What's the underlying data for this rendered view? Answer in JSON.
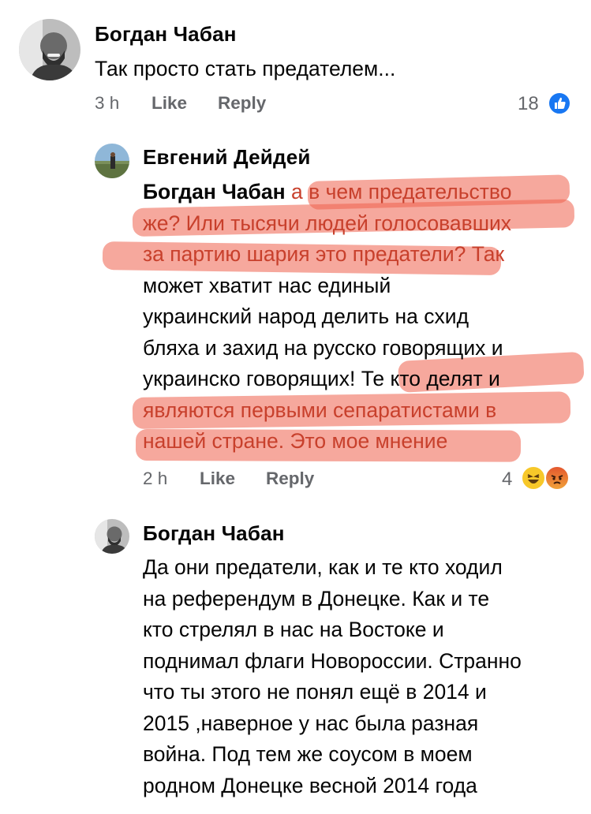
{
  "comments": [
    {
      "author": "Богдан Чабан",
      "text": "Так просто стать предателем...",
      "time": "3 h",
      "like_label": "Like",
      "reply_label": "Reply",
      "reaction_count": "18",
      "reactions": [
        "like-icon"
      ]
    },
    {
      "author": "Евгений Дейдей",
      "mention": "Богдан Чабан",
      "lines": [
        "а в чем предательство",
        "же? Или тысячи людей голосовавших",
        "за партию шария это предатели? Так",
        "может хватит нас единый",
        "украинский народ делить на схид",
        "бляха и захид на русско говорящих и",
        "украинско говорящих! Те кто делят и",
        "являются первыми сепаратистами в",
        "нашей стране. Это мое мнение"
      ],
      "time": "2 h",
      "like_label": "Like",
      "reply_label": "Reply",
      "reaction_count": "4",
      "reactions": [
        "haha-emoji-icon",
        "angry-emoji-icon"
      ]
    },
    {
      "author": "Богдан Чабан",
      "lines": [
        "Да они предатели, как и те кто ходил",
        "на референдум в Донецке. Как и те",
        "кто стрелял в нас на Востоке и",
        "поднимал флаги Новороссии. Странно",
        "что ты этого не понял ещё в 2014 и",
        "2015 ,наверное у нас была разная",
        "война. Под тем же соусом в моем",
        "родном Донецке весной 2014 года"
      ]
    }
  ],
  "colors": {
    "highlight": "#ef604c",
    "highlight_text": "#c8402c",
    "like_blue": "#1877f2",
    "meta_grey": "#65676b"
  }
}
